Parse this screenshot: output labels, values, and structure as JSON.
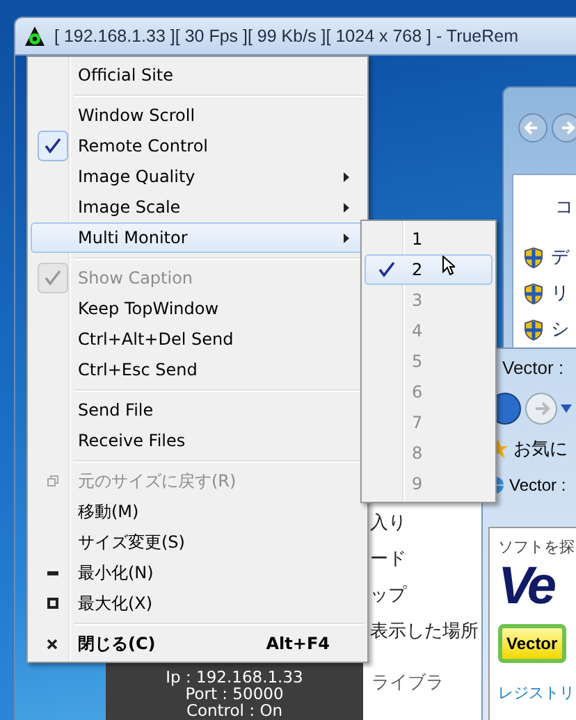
{
  "window": {
    "title": "[ 192.168.1.33 ][ 30 Fps ][ 99 Kb/s ][ 1024 x 768 ] - TrueRem"
  },
  "remote_screen": {
    "control_panel": {
      "heading": "コ",
      "items": [
        "デ",
        "リ",
        "シ"
      ]
    },
    "browser": {
      "title": "Vector :",
      "favorites": "お気に",
      "tab": "Vector :",
      "page_text": "ソフトを探",
      "logo": "Ve",
      "button": "Vector",
      "link": "レジストリ"
    },
    "explorer": {
      "items": [
        "入り",
        "ード",
        "ップ",
        "表示した場所"
      ]
    },
    "viewer_info": [
      "Ip : 192.168.1.33",
      "Port : 50000",
      "Control : On"
    ],
    "library_label": "ライブラ"
  },
  "menu": {
    "items": [
      {
        "kind": "item",
        "label": "Official Site",
        "checked": false,
        "disabled": false,
        "selected": false
      },
      {
        "kind": "separator"
      },
      {
        "kind": "item",
        "label": "Window Scroll",
        "checked": false,
        "disabled": false,
        "selected": false
      },
      {
        "kind": "item",
        "label": "Remote Control",
        "checked": true,
        "disabled": false,
        "selected": false
      },
      {
        "kind": "item",
        "label": "Image Quality",
        "checked": false,
        "disabled": false,
        "selected": false,
        "submenu": true
      },
      {
        "kind": "item",
        "label": "Image Scale",
        "checked": false,
        "disabled": false,
        "selected": false,
        "submenu": true
      },
      {
        "kind": "item",
        "label": "Multi Monitor",
        "checked": false,
        "disabled": false,
        "selected": true,
        "submenu": true
      },
      {
        "kind": "separator"
      },
      {
        "kind": "item",
        "label": "Show Caption",
        "checked": true,
        "disabled": true,
        "selected": false
      },
      {
        "kind": "item",
        "label": "Keep TopWindow",
        "checked": false,
        "disabled": false,
        "selected": false
      },
      {
        "kind": "item",
        "label": "Ctrl+Alt+Del Send",
        "checked": false,
        "disabled": false,
        "selected": false
      },
      {
        "kind": "item",
        "label": "Ctrl+Esc Send",
        "checked": false,
        "disabled": false,
        "selected": false
      },
      {
        "kind": "separator"
      },
      {
        "kind": "item",
        "label": "Send File",
        "checked": false,
        "disabled": false,
        "selected": false
      },
      {
        "kind": "item",
        "label": "Receive Files",
        "checked": false,
        "disabled": false,
        "selected": false
      },
      {
        "kind": "separator"
      },
      {
        "kind": "restore",
        "label": "元のサイズに戻す(R)",
        "checked": false,
        "disabled": true,
        "selected": false
      },
      {
        "kind": "item",
        "label": "移動(M)",
        "checked": false,
        "disabled": false,
        "selected": false
      },
      {
        "kind": "item",
        "label": "サイズ変更(S)",
        "checked": false,
        "disabled": false,
        "selected": false
      },
      {
        "kind": "minimize",
        "label": "最小化(N)",
        "checked": false,
        "disabled": false,
        "selected": false
      },
      {
        "kind": "maximize",
        "label": "最大化(X)",
        "checked": false,
        "disabled": false,
        "selected": false
      },
      {
        "kind": "separator"
      },
      {
        "kind": "close",
        "label": "閉じる(C)",
        "checked": false,
        "disabled": false,
        "selected": false,
        "shortcut": "Alt+F4",
        "bold": true
      }
    ]
  },
  "submenu": {
    "items": [
      {
        "label": "1",
        "checked": false,
        "disabled": false,
        "selected": false
      },
      {
        "label": "2",
        "checked": true,
        "disabled": false,
        "selected": true
      },
      {
        "label": "3",
        "checked": false,
        "disabled": true,
        "selected": false
      },
      {
        "label": "4",
        "checked": false,
        "disabled": true,
        "selected": false
      },
      {
        "label": "5",
        "checked": false,
        "disabled": true,
        "selected": false
      },
      {
        "label": "6",
        "checked": false,
        "disabled": true,
        "selected": false
      },
      {
        "label": "7",
        "checked": false,
        "disabled": true,
        "selected": false
      },
      {
        "label": "8",
        "checked": false,
        "disabled": true,
        "selected": false
      },
      {
        "label": "9",
        "checked": false,
        "disabled": true,
        "selected": false
      }
    ]
  }
}
